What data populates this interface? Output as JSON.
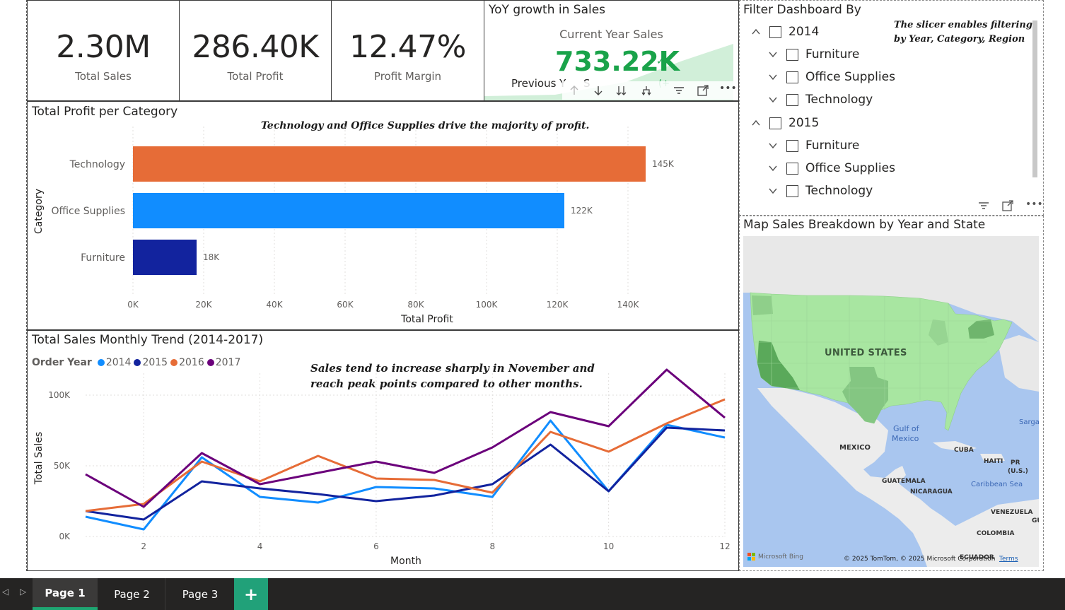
{
  "kpis": [
    {
      "value": "2.30M",
      "label": "Total Sales"
    },
    {
      "value": "286.40K",
      "label": "Total Profit"
    },
    {
      "value": "12.47%",
      "label": "Profit Margin"
    }
  ],
  "yoy": {
    "title": "YoY growth in Sales",
    "current_label": "Current Year Sales",
    "current_value": "733.22K",
    "previous_label": "Previous Y",
    "previous_tail": "S",
    "change_text": "(+",
    "accent": "#1aa34a"
  },
  "slicer": {
    "title": "Filter Dashboard By",
    "note": "The slicer enables filtering by Year, Category, Region",
    "years": [
      {
        "label": "2014",
        "items": [
          "Furniture",
          "Office Supplies",
          "Technology"
        ]
      },
      {
        "label": "2015",
        "items": [
          "Furniture",
          "Office Supplies",
          "Technology"
        ]
      }
    ]
  },
  "profit_chart": {
    "title": "Total Profit per Category",
    "note": "Technology and Office Supplies drive the majority of profit."
  },
  "trend_chart": {
    "title": "Total Sales Monthly Trend (2014-2017)",
    "legend_title": "Order Year",
    "note_line1": "Sales tend to increase sharply in November and",
    "note_line2": "reach peak points compared to other months."
  },
  "map": {
    "title": "Map Sales Breakdown by Year and State",
    "labels": {
      "us": "UNITED STATES",
      "gulf1": "Gulf of",
      "gulf2": "Mexico",
      "mexico": "MEXICO",
      "cuba": "CUBA",
      "haiti": "HAITI",
      "pr1": "PR",
      "pr2": "(U.S.)",
      "guatemala": "GUATEMALA",
      "nicaragua": "NICARAGUA",
      "caribbean": "Caribbean Sea",
      "venezuela": "VENEZUELA",
      "colombia": "COLOMBIA",
      "ecuador": "ECUADOR",
      "sargasso": "Sargas",
      "gu": "GU"
    },
    "bing": "Microsoft Bing",
    "copyright": "© 2025 TomTom, © 2025 Microsoft Corporation",
    "terms": "Terms"
  },
  "tabs": [
    "Page 1",
    "Page 2",
    "Page 3"
  ],
  "add_tab": "+",
  "chart_data": [
    {
      "type": "bar",
      "title": "Total Profit per Category",
      "xlabel": "Total Profit",
      "ylabel": "Category",
      "categories": [
        "Technology",
        "Office Supplies",
        "Furniture"
      ],
      "values": [
        145000,
        122000,
        18000
      ],
      "data_labels": [
        "145K",
        "122K",
        "18K"
      ],
      "colors": [
        "#e66c37",
        "#118dff",
        "#12239e"
      ],
      "xlim": [
        0,
        150000
      ],
      "xticks": [
        0,
        20000,
        40000,
        60000,
        80000,
        100000,
        120000,
        140000
      ],
      "xtick_labels": [
        "0K",
        "20K",
        "40K",
        "60K",
        "80K",
        "100K",
        "120K",
        "140K"
      ]
    },
    {
      "type": "line",
      "title": "Total Sales Monthly Trend (2014-2017)",
      "xlabel": "Month",
      "ylabel": "Total Sales",
      "x": [
        1,
        2,
        3,
        4,
        5,
        6,
        7,
        8,
        9,
        10,
        11,
        12
      ],
      "xlim": [
        1,
        12
      ],
      "ylim": [
        0,
        118000
      ],
      "xticks": [
        2,
        4,
        6,
        8,
        10,
        12
      ],
      "yticks": [
        0,
        50000,
        100000
      ],
      "ytick_labels": [
        "0K",
        "50K",
        "100K"
      ],
      "legend_position": "top-left",
      "series": [
        {
          "name": "2014",
          "color": "#118dff",
          "values": [
            14000,
            5000,
            56000,
            28000,
            24000,
            35000,
            34000,
            28000,
            82000,
            32000,
            79000,
            70000
          ]
        },
        {
          "name": "2015",
          "color": "#12239e",
          "values": [
            18000,
            12000,
            39000,
            34000,
            30000,
            25000,
            29000,
            37000,
            65000,
            32000,
            77000,
            75000
          ]
        },
        {
          "name": "2016",
          "color": "#e66c37",
          "values": [
            18000,
            23000,
            53000,
            39000,
            57000,
            41000,
            40000,
            31000,
            74000,
            60000,
            80000,
            97000
          ]
        },
        {
          "name": "2017",
          "color": "#6b007b",
          "values": [
            44000,
            21000,
            59000,
            37000,
            45000,
            53000,
            45000,
            63000,
            88000,
            78000,
            118000,
            84000
          ]
        }
      ]
    }
  ]
}
